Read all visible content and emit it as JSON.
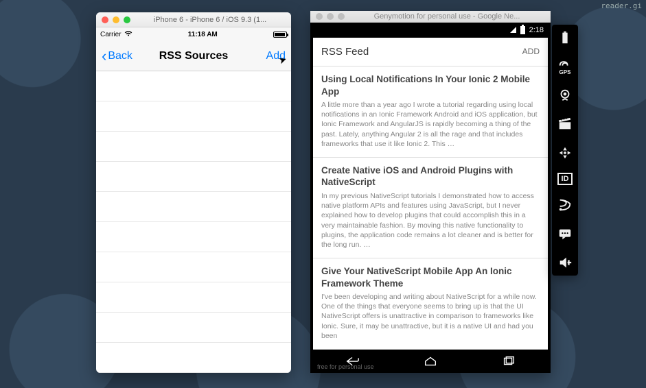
{
  "watermark": "reader.gi",
  "ios": {
    "window_title": "iPhone 6 - iPhone 6 / iOS 9.3 (1...",
    "carrier": "Carrier",
    "time": "11:18 AM",
    "back_label": "Back",
    "title": "RSS Sources",
    "add_label": "Add"
  },
  "android": {
    "window_title": "Genymotion for personal use - Google Ne...",
    "time": "2:18",
    "header": "RSS Feed",
    "add_label": "ADD",
    "footer_text": "free for personal use",
    "items": [
      {
        "title": "Using Local Notifications In Your Ionic 2 Mobile App",
        "desc": "A little more than a year ago I wrote a tutorial regarding using local notifications in an Ionic Framework Android and iOS application, but Ionic Framework and AngularJS is rapidly becoming a thing of the past.  Lately, anything Angular 2 is all the rage and that includes frameworks that use it like Ionic 2.  This …"
      },
      {
        "title": "Create Native iOS and Android Plugins with NativeScript",
        "desc": "In my previous NativeScript tutorials I demonstrated how to access native platform APIs and features using JavaScript, but I never explained how to develop plugins that could accomplish this in a very maintainable fashion.  By moving this native functionality to plugins, the application code remains a lot cleaner and is better for the long run. …"
      },
      {
        "title": "Give Your NativeScript Mobile App An Ionic Framework Theme",
        "desc": "I've been developing and writing about NativeScript for a while now.  One of the things that everyone seems to bring up is that the UI NativeScript offers is unattractive in comparison to frameworks like Ionic.  Sure, it may be unattractive, but it is a native UI and had you been"
      }
    ]
  },
  "toolbar": {
    "gps_label": "GPS",
    "id_label": "ID"
  }
}
